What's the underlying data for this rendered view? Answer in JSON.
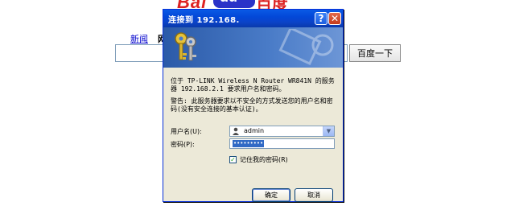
{
  "background_page": {
    "logo_latin": "Bai",
    "logo_paw": "du",
    "logo_chinese": "百度",
    "nav_news": "新闻",
    "nav_web": "网",
    "search_button": "百度一下"
  },
  "dialog": {
    "title": "连接到 192.168.",
    "help_glyph": "?",
    "close_glyph": "✕",
    "message": "位于 TP-LINK Wireless N Router WR841N 的服务器 192.168.2.1 要求用户名和密码。",
    "warning": "警告: 此服务器要求以不安全的方式发送您的用户名和密码(没有安全连接的基本认证)。",
    "username_label": "用户名(U):",
    "username_value": "admin",
    "password_label": "密码(P):",
    "password_value": "•••••••••",
    "remember_label": "记住我的密码(R)",
    "remember_checked": true,
    "ok_label": "确定",
    "cancel_label": "取消"
  },
  "colors": {
    "titlebar": "#0a4fdc",
    "dialog_face": "#ece9d8",
    "selection": "#316ac5"
  }
}
